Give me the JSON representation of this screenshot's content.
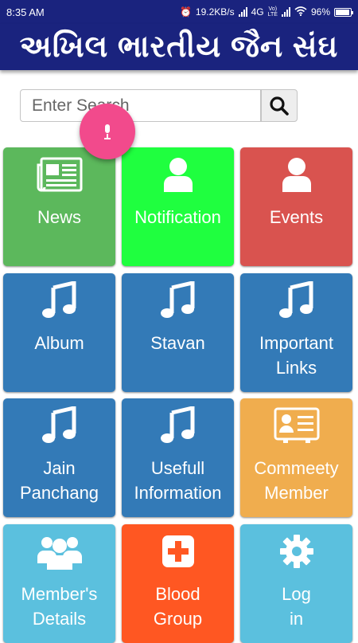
{
  "status_bar": {
    "time": "8:35 AM",
    "speed": "19.2KB/s",
    "network": "4G",
    "volte_top": "Vo)",
    "volte_bottom": "LTE",
    "battery": "96%",
    "battery_level": 0.96
  },
  "header": {
    "title": "અખિલ ભારતીય જૈન સંઘ",
    "color": "#1a237e"
  },
  "search": {
    "placeholder": "Enter Search",
    "value": ""
  },
  "tiles": [
    {
      "label": "News",
      "icon": "newspaper-icon",
      "color": "#5cb85c"
    },
    {
      "label": "Notification",
      "icon": "user-icon",
      "color": "#1fff3f"
    },
    {
      "label": "Events",
      "icon": "user-icon",
      "color": "#d9534f"
    },
    {
      "label": "Album",
      "icon": "music-note-icon",
      "color": "#337ab7"
    },
    {
      "label": "Stavan",
      "icon": "music-note-icon",
      "color": "#337ab7"
    },
    {
      "label": "Important\nLinks",
      "icon": "music-note-icon",
      "color": "#337ab7"
    },
    {
      "label": "Jain\nPanchang",
      "icon": "music-note-icon",
      "color": "#337ab7"
    },
    {
      "label": "Usefull\nInformation",
      "icon": "music-note-icon",
      "color": "#337ab7"
    },
    {
      "label": "Commeety\nMember",
      "icon": "contact-card-icon",
      "color": "#f0ad4e"
    },
    {
      "label": "Member's\nDetails",
      "icon": "users-group-icon",
      "color": "#5bc0de"
    },
    {
      "label": "Blood\nGroup",
      "icon": "medical-plus-icon",
      "color": "#ff5722"
    },
    {
      "label": "Log\nin",
      "icon": "gear-icon",
      "color": "#5bc0de"
    }
  ]
}
